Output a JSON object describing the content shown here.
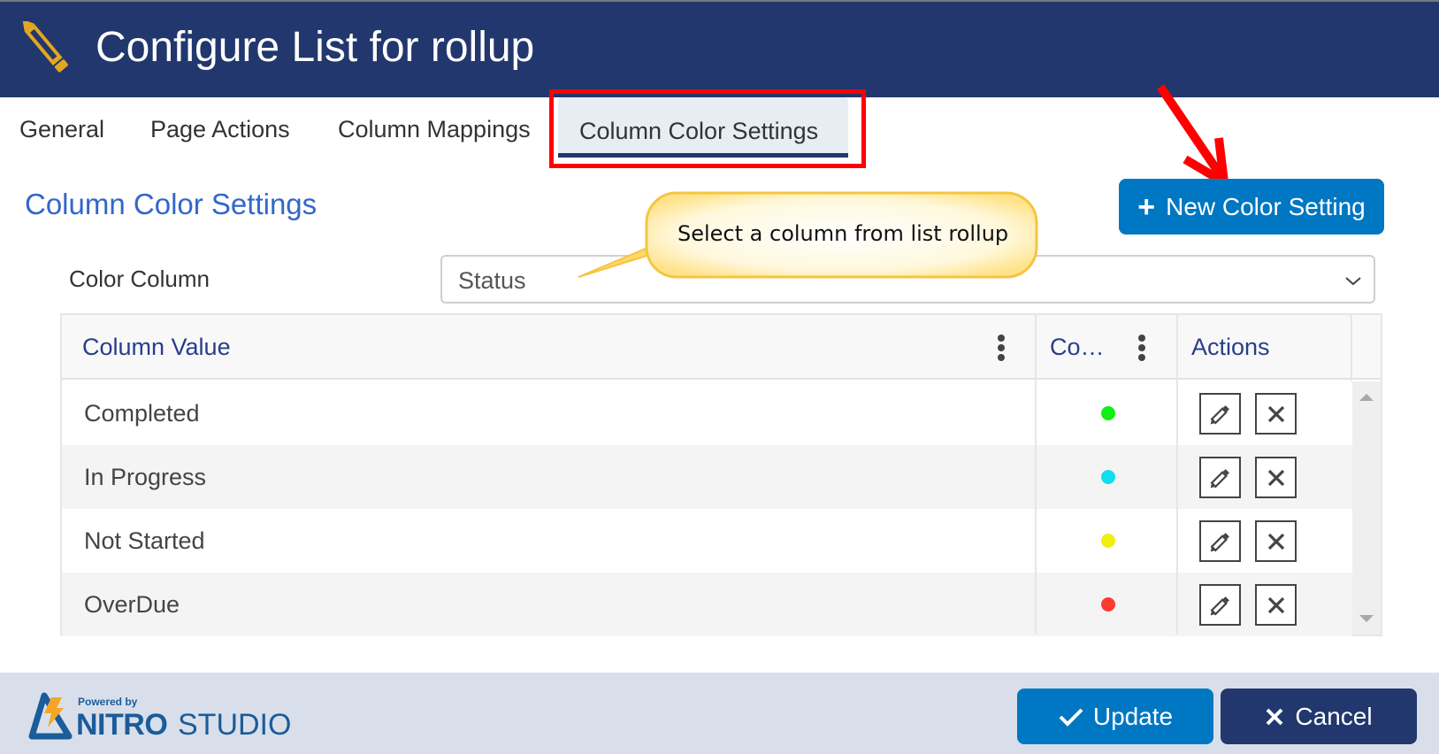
{
  "header": {
    "title": "Configure List for rollup",
    "icon": "pencil-icon",
    "icon_color": "#e5a620",
    "background": "#21376e"
  },
  "tabs": [
    {
      "label": "General",
      "active": false
    },
    {
      "label": "Page Actions",
      "active": false
    },
    {
      "label": "Column Mappings",
      "active": false
    },
    {
      "label": "Column Color Settings",
      "active": true
    }
  ],
  "annotations": {
    "highlight_color": "#ff0000",
    "callout_text": "Select a column from list rollup"
  },
  "section": {
    "title": "Column Color Settings",
    "new_button_label": "New Color Setting",
    "new_button_icon": "plus-icon"
  },
  "color_column": {
    "label": "Color Column",
    "selected": "Status"
  },
  "grid": {
    "columns": [
      {
        "label": "Column Value"
      },
      {
        "label": "Co…"
      },
      {
        "label": "Actions"
      }
    ],
    "rows": [
      {
        "value": "Completed",
        "color": "#11ee11"
      },
      {
        "value": "In Progress",
        "color": "#11ddee"
      },
      {
        "value": "Not Started",
        "color": "#eeee11"
      },
      {
        "value": "OverDue",
        "color": "#ff3b30"
      }
    ]
  },
  "footer": {
    "powered_by": "Powered by",
    "brand_bold": "NITRO",
    "brand_light": "STUDIO",
    "update_label": "Update",
    "cancel_label": "Cancel"
  }
}
